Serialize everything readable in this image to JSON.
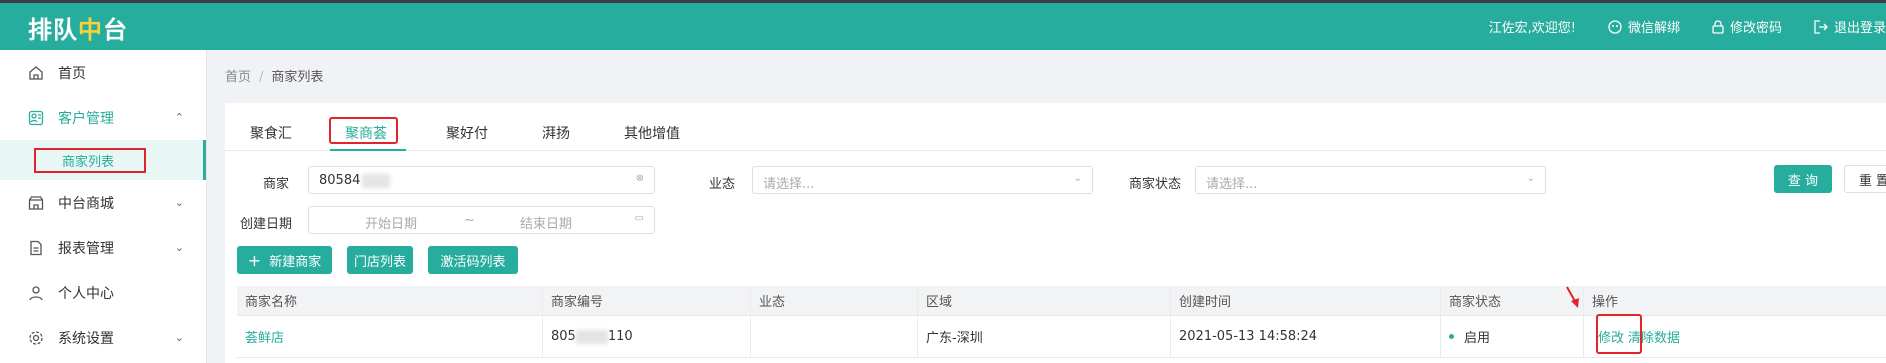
{
  "topbar": {
    "logo_prefix": "排队",
    "logo_mid": "中",
    "logo_suffix": "台",
    "welcome": "江佐宏,欢迎您!",
    "wechat_unbind": "微信解绑",
    "change_password": "修改密码",
    "logout": "退出登录"
  },
  "sidebar": {
    "home": "首页",
    "customer_mgmt": "客户管理",
    "merchant_list": "商家列表",
    "mall": "中台商城",
    "report_mgmt": "报表管理",
    "personal_center": "个人中心",
    "system_settings": "系统设置"
  },
  "breadcrumb": {
    "home": "首页",
    "current": "商家列表",
    "separator": "/"
  },
  "tabs": [
    "聚食汇",
    "聚商荟",
    "聚好付",
    "湃扬",
    "其他增值"
  ],
  "filters": {
    "merchant_label": "商家",
    "merchant_value": "80584",
    "business_label": "业态",
    "business_placeholder": "请选择...",
    "status_label": "商家状态",
    "status_placeholder": "请选择...",
    "date_label": "创建日期",
    "start_placeholder": "开始日期",
    "date_sep": "~",
    "end_placeholder": "结束日期",
    "query_button": "查 询",
    "reset_button": "重 置"
  },
  "actions": {
    "new_merchant": "新建商家",
    "store_list": "门店列表",
    "activation_codes": "激活码列表"
  },
  "table": {
    "headers": [
      "商家名称",
      "商家编号",
      "业态",
      "区域",
      "创建时间",
      "商家状态",
      "操作"
    ],
    "rows": [
      {
        "name": "荟鲜店",
        "id_prefix": "805",
        "id_suffix": "110",
        "business": "",
        "region": "广东-深圳",
        "created": "2021-05-13 14:58:24",
        "status": "启用",
        "op_edit": "修改",
        "op_clear": "清除数据"
      }
    ]
  },
  "colors": {
    "brand": "#26ad9d",
    "highlight_box": "#e0242b",
    "logo_accent": "#f5d23a"
  }
}
